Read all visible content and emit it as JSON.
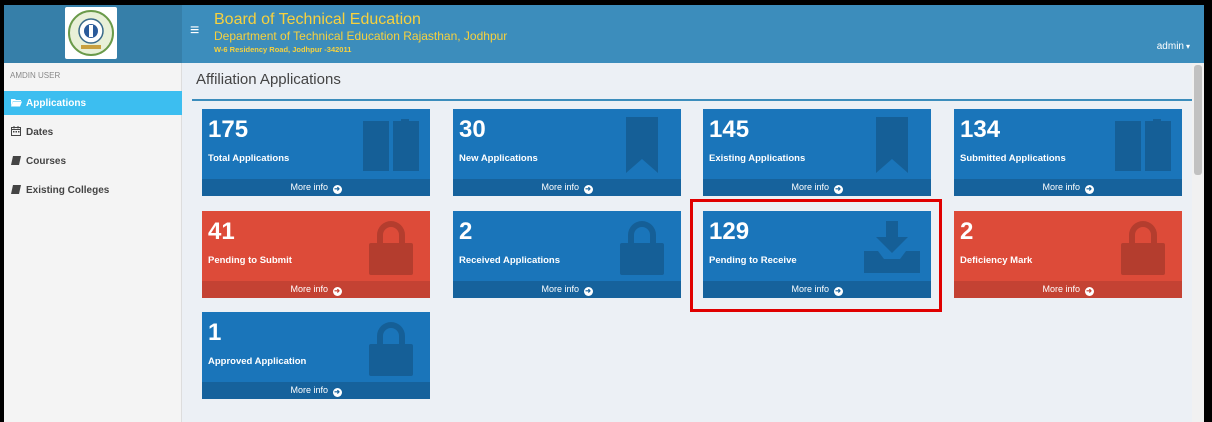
{
  "header": {
    "title": "Board of Technical Education",
    "subtitle": "Department of Technical Education Rajasthan, Jodhpur",
    "address": "W-6 Residency Road, Jodhpur -342011",
    "hamburger_icon": "≡",
    "user": "admin"
  },
  "sidebar": {
    "header": "AMDIN USER",
    "items": [
      {
        "label": "Applications",
        "icon": "folder-open-icon",
        "glyph": "🗁"
      },
      {
        "label": "Dates",
        "icon": "calendar-icon",
        "glyph": "📅"
      },
      {
        "label": "Courses",
        "icon": "book-icon",
        "glyph": "▰"
      },
      {
        "label": "Existing Colleges",
        "icon": "book-icon",
        "glyph": "▰"
      }
    ]
  },
  "main": {
    "title": "Affiliation Applications",
    "more_info": "More info",
    "tiles": [
      {
        "value": "175",
        "label": "Total Applications",
        "color": "#1a75ba",
        "icon": "book-open-icon"
      },
      {
        "value": "30",
        "label": "New Applications",
        "color": "#1a75ba",
        "icon": "bookmark-icon"
      },
      {
        "value": "145",
        "label": "Existing Applications",
        "color": "#1a75ba",
        "icon": "bookmark-icon"
      },
      {
        "value": "134",
        "label": "Submitted Applications",
        "color": "#1a75ba",
        "icon": "book-open-icon"
      },
      {
        "value": "41",
        "label": "Pending to Submit",
        "color": "#dd4b39",
        "icon": "lock-icon"
      },
      {
        "value": "2",
        "label": "Received Applications",
        "color": "#1a75ba",
        "icon": "lock-icon"
      },
      {
        "value": "129",
        "label": "Pending to Receive",
        "color": "#1a75ba",
        "icon": "inbox-download-icon"
      },
      {
        "value": "2",
        "label": "Deficiency Mark",
        "color": "#dd4b39",
        "icon": "lock-icon"
      },
      {
        "value": "1",
        "label": "Approved Application",
        "color": "#1a75ba",
        "icon": "lock-icon"
      }
    ]
  },
  "colors": {
    "header": "#3c8dbc",
    "accent_active": "#3cbef0",
    "highlight": "#e00000"
  }
}
